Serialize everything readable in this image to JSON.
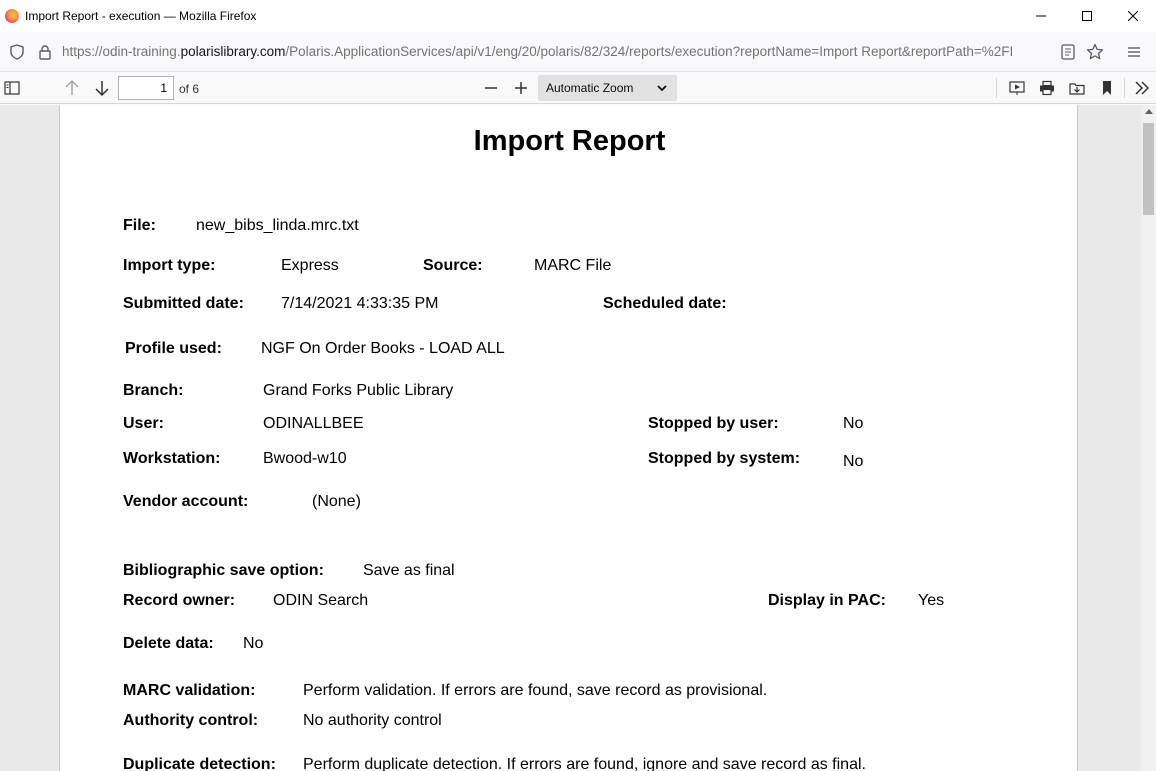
{
  "browser": {
    "window_title": "Import Report - execution — Mozilla Firefox",
    "url_prefix": "https://odin-training.",
    "url_host": "polarislibrary.com",
    "url_rest": "/Polaris.ApplicationServices/api/v1/eng/20/polaris/82/324/reports/execution?reportName=Import Report&reportPath=%2FI"
  },
  "pdf_toolbar": {
    "page_number": "1",
    "page_count": "of 6",
    "zoom_label": "Automatic Zoom"
  },
  "report": {
    "title": "Import Report",
    "file": {
      "label": "File:",
      "value": "new_bibs_linda.mrc.txt"
    },
    "import_type": {
      "label": "Import type:",
      "value": "Express"
    },
    "source": {
      "label": "Source:",
      "value": "MARC File"
    },
    "submitted_date": {
      "label": "Submitted date:",
      "value": "7/14/2021 4:33:35 PM"
    },
    "scheduled_date": {
      "label": "Scheduled date:",
      "value": ""
    },
    "profile_used": {
      "label": "Profile used:",
      "value": "NGF On Order Books - LOAD ALL"
    },
    "branch": {
      "label": "Branch:",
      "value": "Grand Forks Public Library"
    },
    "user": {
      "label": "User:",
      "value": "ODINALLBEE"
    },
    "stopped_by_user": {
      "label": "Stopped by user:",
      "value": "No"
    },
    "workstation": {
      "label": "Workstation:",
      "value": "Bwood-w10"
    },
    "stopped_by_system": {
      "label": "Stopped by system:",
      "value": "No"
    },
    "vendor_account": {
      "label": "Vendor account:",
      "value": "(None)"
    },
    "bib_save_option": {
      "label": "Bibliographic save option:",
      "value": "Save as final"
    },
    "record_owner": {
      "label": "Record owner:",
      "value": "ODIN Search"
    },
    "display_in_pac": {
      "label": "Display in PAC:",
      "value": "Yes"
    },
    "delete_data": {
      "label": "Delete data:",
      "value": "No"
    },
    "marc_validation": {
      "label": "MARC validation:",
      "value": "Perform validation. If errors are found, save record as provisional."
    },
    "authority_control": {
      "label": "Authority control:",
      "value": "No authority control"
    },
    "duplicate_detection": {
      "label": "Duplicate detection:",
      "value": "Perform duplicate detection. If errors are found, ignore and save record as final."
    }
  }
}
